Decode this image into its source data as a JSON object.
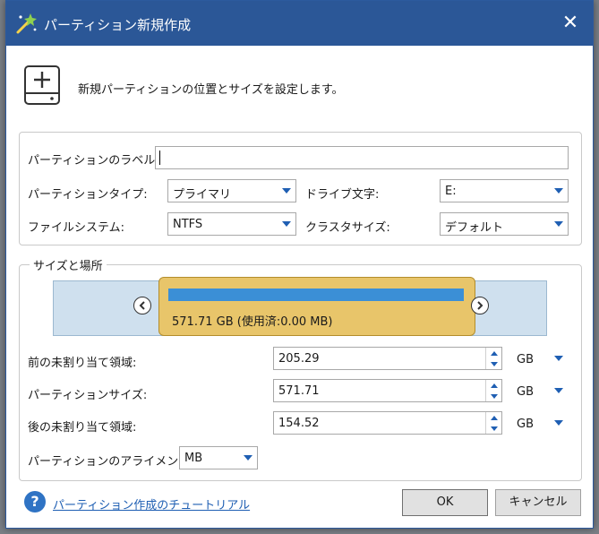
{
  "window": {
    "title": "パーティション新規作成",
    "close_symbol": "✕"
  },
  "header": {
    "description": "新規パーティションの位置とサイズを設定します。"
  },
  "partition": {
    "label_text": "パーティションのラベル:",
    "label_value": "",
    "type_text": "パーティションタイプ:",
    "type_value": "プライマリ",
    "drive_letter_text": "ドライブ文字:",
    "drive_letter_value": "E:",
    "filesystem_text": "ファイルシステム:",
    "filesystem_value": "NTFS",
    "cluster_size_text": "クラスタサイズ:",
    "cluster_size_value": "デフォルト"
  },
  "size_location": {
    "group_title": "サイズと場所",
    "partition_info": "571.71 GB (使用済:0.00 MB)",
    "used_fraction": 0.0,
    "unallocated_before_label": "前の未割り当て領域:",
    "unallocated_before_value": "205.29",
    "partition_size_label": "パーティションサイズ:",
    "partition_size_value": "571.71",
    "unallocated_after_label": "後の未割り当て領域:",
    "unallocated_after_value": "154.52",
    "unit": "GB",
    "alignment_label": "パーティションのアライメント:",
    "alignment_value": "MB"
  },
  "footer": {
    "help_symbol": "?",
    "tutorial_link": "パーティション作成のチュートリアル",
    "ok_label": "OK",
    "cancel_label": "キャンセル"
  },
  "colors": {
    "titlebar": "#2b5797",
    "partition_block": "#e8c56a",
    "disk_bar": "#cfe0ee",
    "usage_bar": "#3b8fd6",
    "accent": "#1f5fb3"
  },
  "icons": [
    "wizard-icon",
    "close-icon",
    "new-partition-icon",
    "chevron-left-icon",
    "chevron-right-icon",
    "spin-up-icon",
    "spin-down-icon",
    "dropdown-arrow-icon",
    "help-icon"
  ]
}
